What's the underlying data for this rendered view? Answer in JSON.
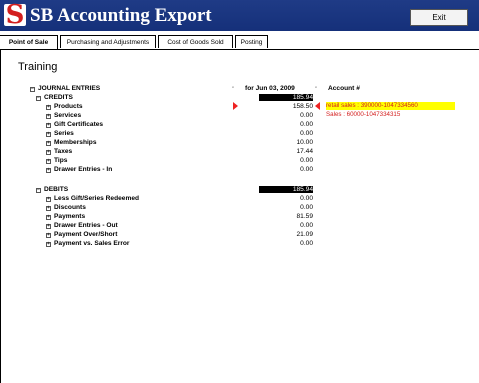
{
  "app": {
    "logo_letter": "S",
    "title": "SB Accounting Export",
    "exit_label": "Exit",
    "colors": {
      "header": "#1a3580",
      "logo": "#d31f1f",
      "highlight": "#ffff00",
      "account_text": "#d42020"
    }
  },
  "tabs": [
    {
      "label": "Point of Sale"
    },
    {
      "label": "Purchasing and Adjustments"
    },
    {
      "label": "Cost of Goods Sold"
    },
    {
      "label": "Posting"
    }
  ],
  "section_title": "Training",
  "columns": {
    "date": "for Jun 03, 2009",
    "account": "Account #",
    "bullet": "◦"
  },
  "journal": {
    "root": "JOURNAL ENTRIES",
    "credits": {
      "label": "CREDITS",
      "total": "185.94",
      "items": [
        {
          "label": "Products",
          "value": "158.50"
        },
        {
          "label": "Services",
          "value": "0.00"
        },
        {
          "label": "Gift Certificates",
          "value": "0.00"
        },
        {
          "label": "Series",
          "value": "0.00"
        },
        {
          "label": "Memberships",
          "value": "10.00"
        },
        {
          "label": "Taxes",
          "value": "17.44"
        },
        {
          "label": "Tips",
          "value": "0.00"
        },
        {
          "label": "Drawer Entries - In",
          "value": "0.00"
        }
      ]
    },
    "debits": {
      "label": "DEBITS",
      "total": "185.94",
      "items": [
        {
          "label": "Less Gift/Series Redeemed",
          "value": "0.00"
        },
        {
          "label": "Discounts",
          "value": "0.00"
        },
        {
          "label": "Payments",
          "value": "81.59"
        },
        {
          "label": "Drawer Entries - Out",
          "value": "0.00"
        },
        {
          "label": "Payment Over/Short",
          "value": "21.09"
        },
        {
          "label": "Payment vs. Sales Error",
          "value": "0.00"
        }
      ]
    }
  },
  "accounts": {
    "retail": "retail sales : 390000-1047334560",
    "sales": "Sales : 60000-1047334315"
  }
}
